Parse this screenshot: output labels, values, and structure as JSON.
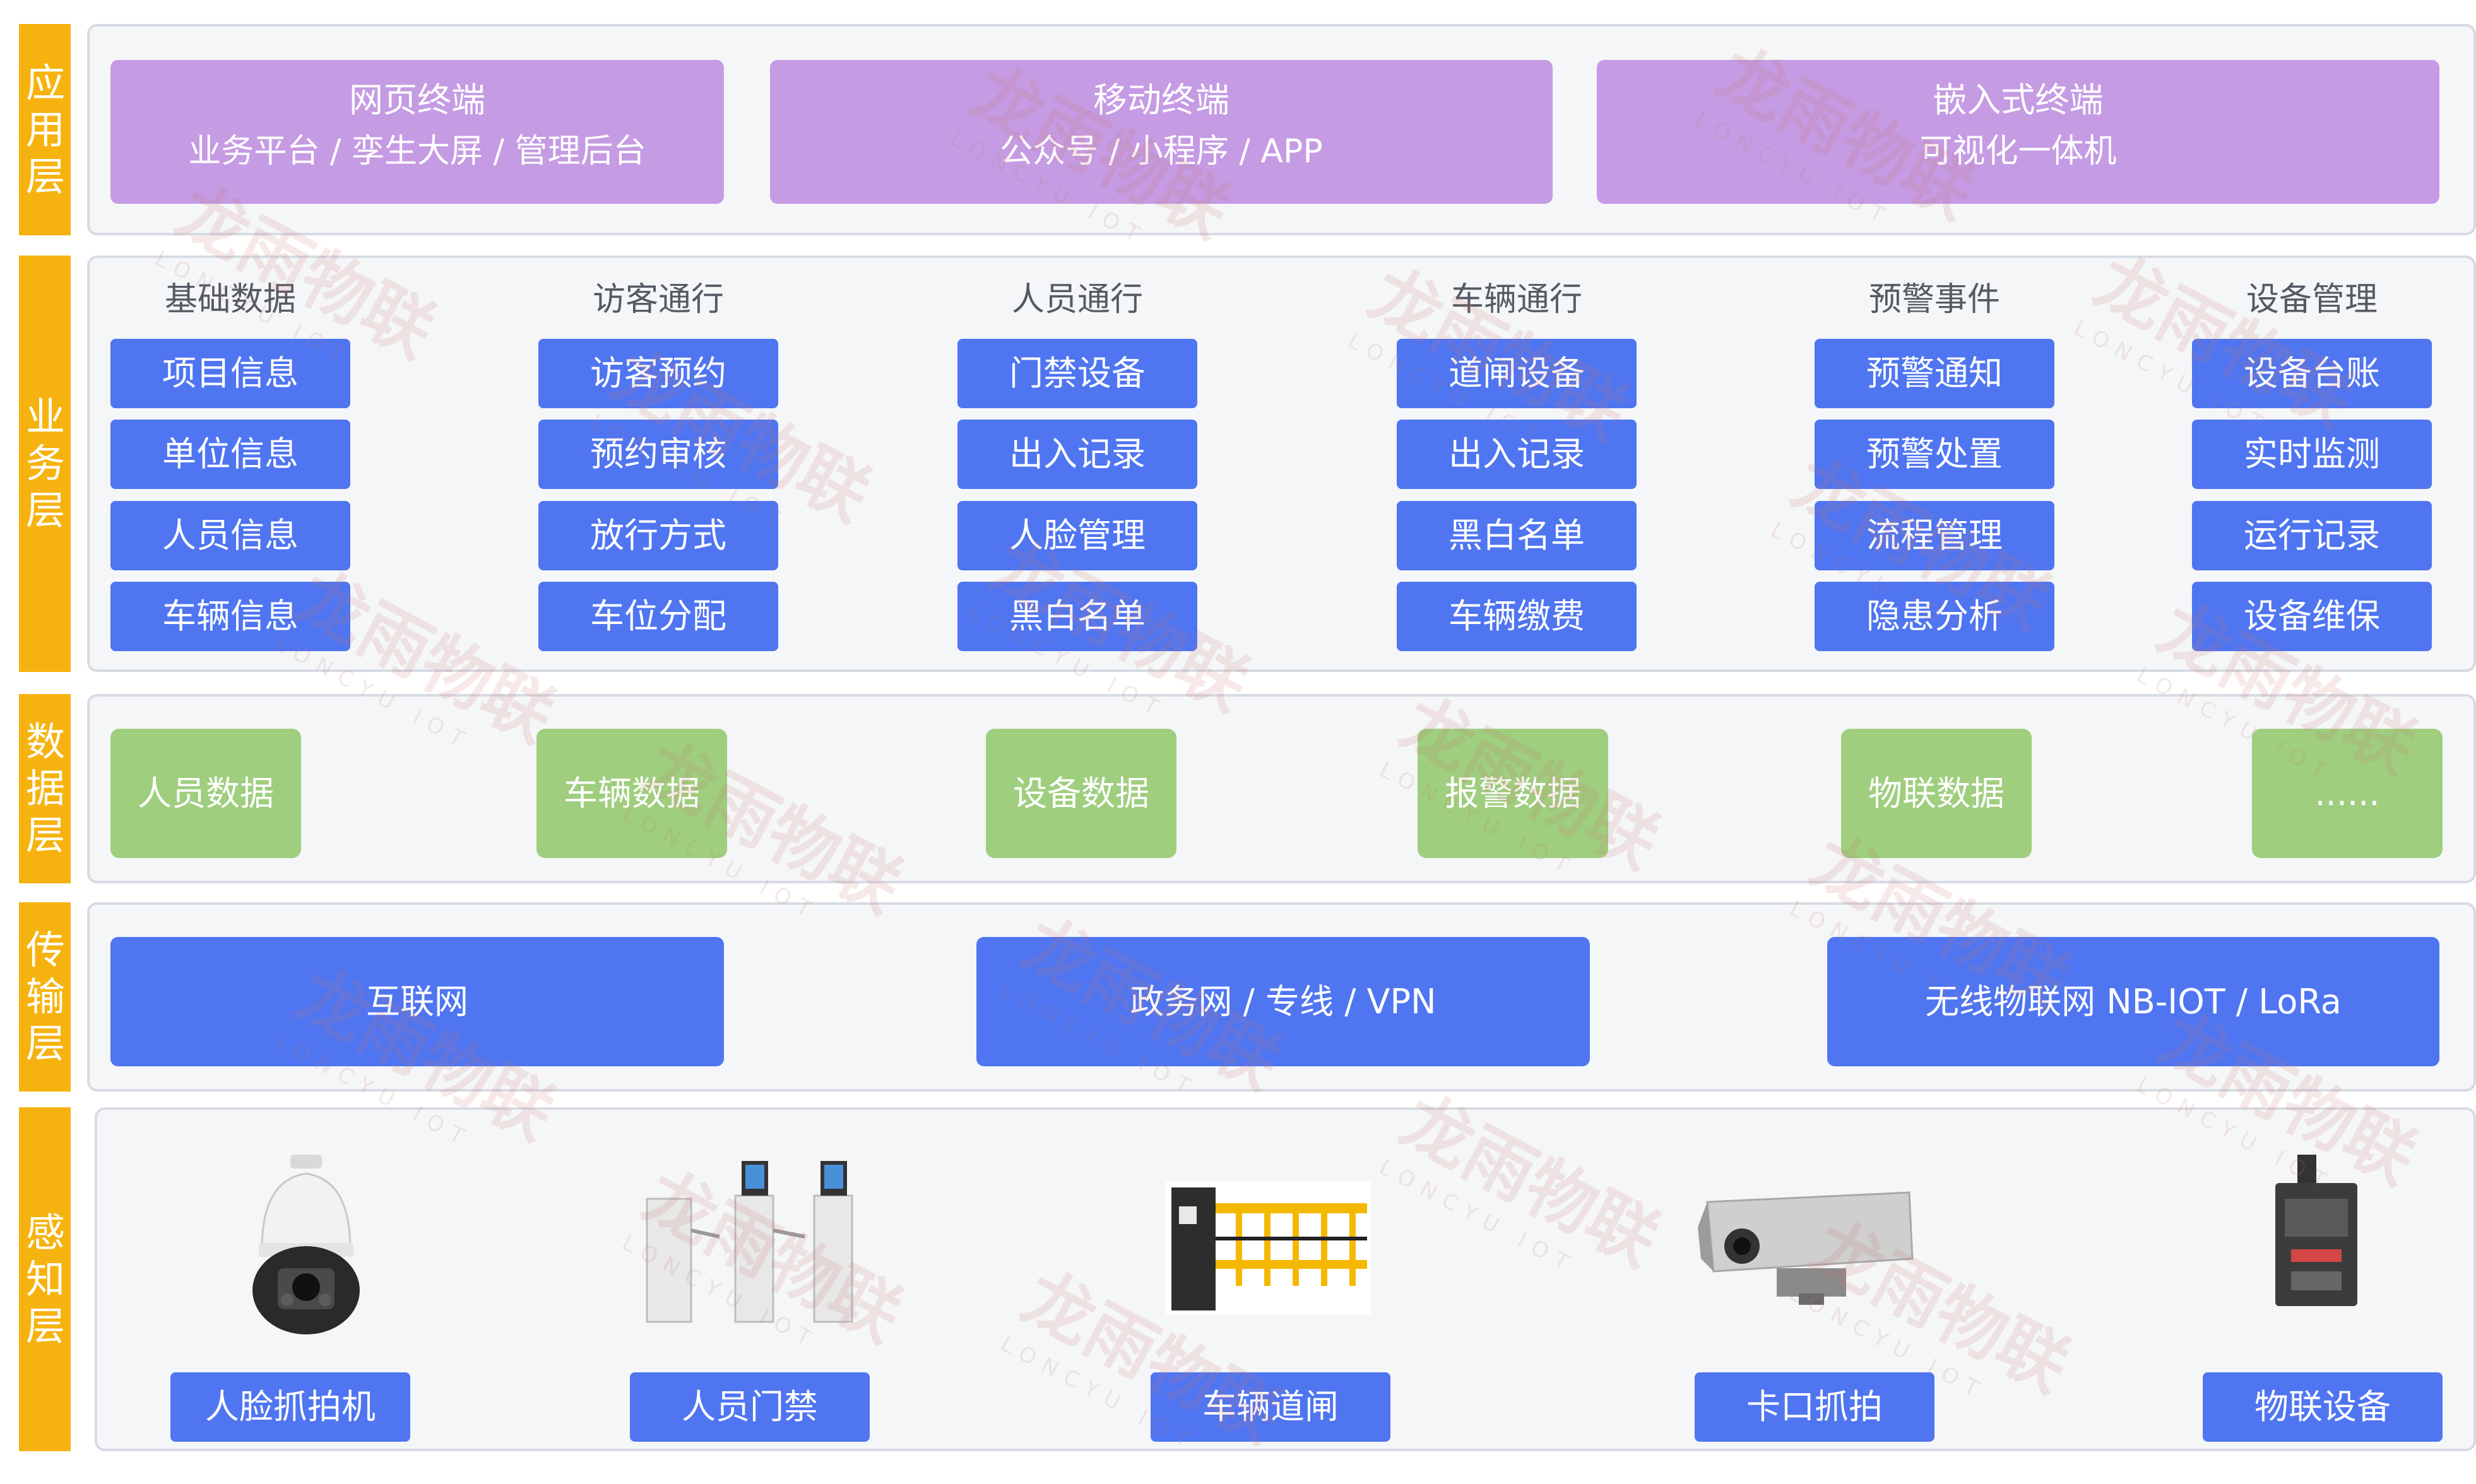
{
  "layers": {
    "app": "应用层",
    "business": "业务层",
    "data": "数据层",
    "transport": "传输层",
    "perception": "感知层"
  },
  "app_layer": [
    {
      "title": "网页终端",
      "sub": "业务平台 / 孪生大屏 / 管理后台"
    },
    {
      "title": "移动终端",
      "sub": "公众号 / 小程序 / APP"
    },
    {
      "title": "嵌入式终端",
      "sub": "可视化一体机"
    }
  ],
  "business_layer": [
    {
      "head": "基础数据",
      "items": [
        "项目信息",
        "单位信息",
        "人员信息",
        "车辆信息"
      ]
    },
    {
      "head": "访客通行",
      "items": [
        "访客预约",
        "预约审核",
        "放行方式",
        "车位分配"
      ]
    },
    {
      "head": "人员通行",
      "items": [
        "门禁设备",
        "出入记录",
        "人脸管理",
        "黑白名单"
      ]
    },
    {
      "head": "车辆通行",
      "items": [
        "道闸设备",
        "出入记录",
        "黑白名单",
        "车辆缴费"
      ]
    },
    {
      "head": "预警事件",
      "items": [
        "预警通知",
        "预警处置",
        "流程管理",
        "隐患分析"
      ]
    },
    {
      "head": "设备管理",
      "items": [
        "设备台账",
        "实时监测",
        "运行记录",
        "设备维保"
      ]
    }
  ],
  "data_layer": [
    "人员数据",
    "车辆数据",
    "设备数据",
    "报警数据",
    "物联数据",
    "......"
  ],
  "transport_layer": [
    "互联网",
    "政务网 / 专线 / VPN",
    "无线物联网 NB-IOT / LoRa"
  ],
  "perception_layer": [
    "人脸抓拍机",
    "人员门禁",
    "车辆道闸",
    "卡口抓拍",
    "物联设备"
  ],
  "watermark": {
    "brand": "龙雨物联",
    "sub": "LONCYU IOT"
  },
  "colors": {
    "layer_label": "#f6b30f",
    "app_box": "#c59be3",
    "blue_button": "#4f75f1",
    "green_box": "#9fce7e",
    "panel": "#f5f6f8"
  }
}
